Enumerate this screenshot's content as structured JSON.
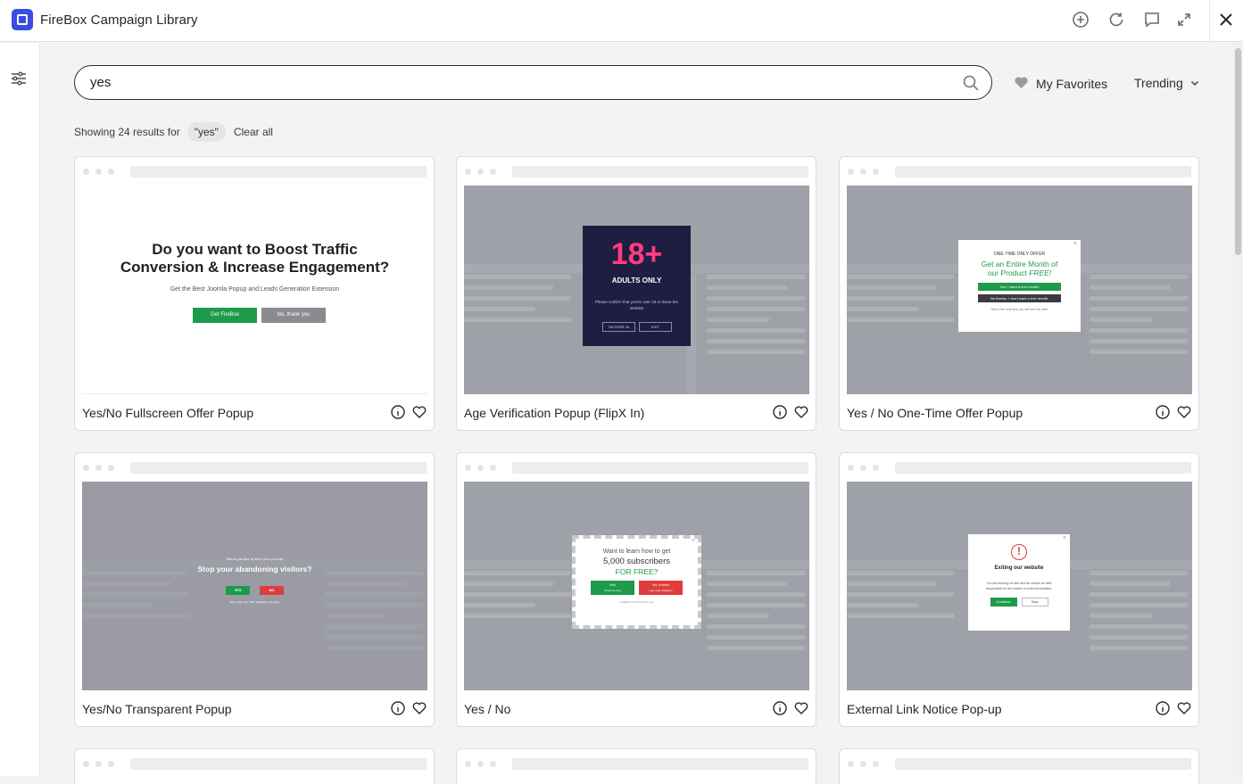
{
  "app": {
    "title": "FireBox Campaign Library"
  },
  "search": {
    "value": "yes",
    "placeholder": ""
  },
  "toolbar": {
    "favorites_label": "My Favorites",
    "sort_label": "Trending"
  },
  "results": {
    "prefix": "Showing 24 results for",
    "query_chip": "\"yes\"",
    "clear_label": "Clear all"
  },
  "cards": [
    {
      "title": "Yes/No Fullscreen Offer Popup",
      "preview": {
        "heading_line1": "Do you want to Boost Traffic",
        "heading_line2": "Conversion & Increase Engagement?",
        "sub": "Get the Best Joomla Popup and Leads Generation Extension",
        "btn_yes": "Get FireBox",
        "btn_no": "No, thank you"
      }
    },
    {
      "title": "Age Verification Popup (FlipX In)",
      "preview": {
        "big": "18+",
        "label": "ADULTS ONLY",
        "text": "Please confirm that you're over 18 or leave the website",
        "btn_yes": "I'M OVER 18",
        "btn_no": "EXIT"
      }
    },
    {
      "title": "Yes / No One-Time Offer Popup",
      "preview": {
        "kicker": "ONE-TIME ONLY OFFER",
        "line1": "Get an Entire Month of",
        "line2": "our Product",
        "free": "FREE!",
        "btn_yes": "Yes, I want a free month!",
        "btn_no": "No thanks, I don't want a free month.",
        "note": "This is the only time you will see this offer."
      }
    },
    {
      "title": "Yes/No Transparent Popup",
      "preview": {
        "kicker": "Would you like to learn how you can",
        "heading": "Stop your abandoning visitors?",
        "btn_yes": "YES",
        "btn_no": "NO",
        "note": "Take a free trial. Offer available until today."
      }
    },
    {
      "title": "Yes / No",
      "preview": {
        "line1": "Want to learn how to get",
        "line2": "5,000 subscribers",
        "line3": "FOR FREE?",
        "btn_yes": "Yes!",
        "btn_yes_sub": "Show me how",
        "btn_no": "No, thanks",
        "btn_no_sub": "I get more followers",
        "note": "Available for limited time only"
      }
    },
    {
      "title": "External Link Notice Pop-up",
      "preview": {
        "heading": "Exiting our website",
        "text": "You are leaving our site and we cannot be held responsible for the content of external websites.",
        "btn_yes": "Continue",
        "btn_no": "Stay"
      }
    }
  ],
  "colors": {
    "accent": "#3b4de0",
    "green": "#1e9a4b",
    "red": "#e03c3c",
    "pink": "#ff3d7f",
    "navy": "#1f1d42"
  },
  "icons": [
    "app-logo-icon",
    "add-circle-icon",
    "refresh-icon",
    "comment-icon",
    "expand-icon",
    "close-icon",
    "filter-icon",
    "search-icon",
    "heart-icon",
    "chevron-down-icon",
    "info-icon"
  ]
}
